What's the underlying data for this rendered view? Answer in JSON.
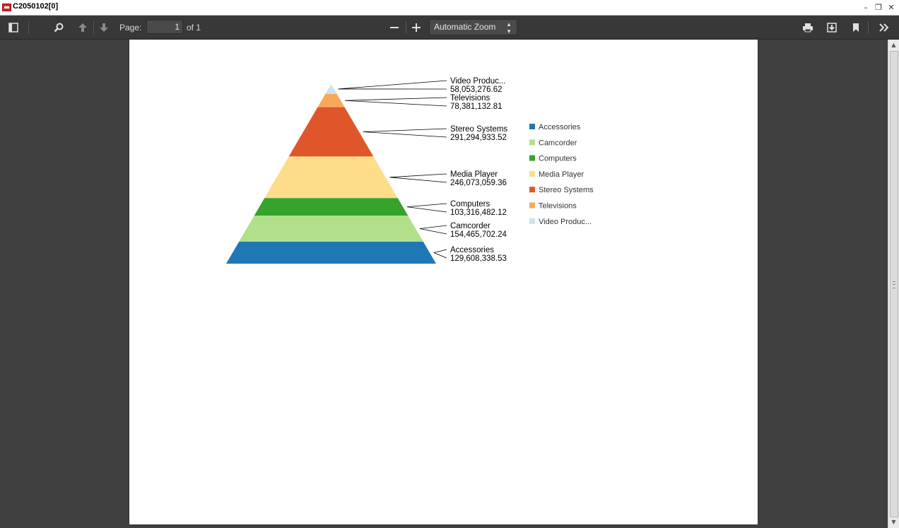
{
  "window": {
    "title": "C2050102[0]"
  },
  "toolbar": {
    "page_label": "Page:",
    "page_value": "1",
    "page_count": "of 1",
    "zoom_value": "Automatic Zoom"
  },
  "chart_data": {
    "type": "pyramid",
    "segments": [
      {
        "name": "Video Produc...",
        "value_label": "58,053,276.62",
        "value": 58053276.62,
        "color": "#cfe1f0"
      },
      {
        "name": "Televisions",
        "value_label": "78,381,132.81",
        "value": 78381132.81,
        "color": "#f9a75b"
      },
      {
        "name": "Stereo Systems",
        "value_label": "291,294,933.52",
        "value": 291294933.52,
        "color": "#e0562b"
      },
      {
        "name": "Media Player",
        "value_label": "246,073,059.36",
        "value": 246073059.36,
        "color": "#fddd8a"
      },
      {
        "name": "Computers",
        "value_label": "103,316,482.12",
        "value": 103316482.12,
        "color": "#36a32c"
      },
      {
        "name": "Camcorder",
        "value_label": "154,465,702.24",
        "value": 154465702.24,
        "color": "#b2df8a"
      },
      {
        "name": "Accessories",
        "value_label": "129,608,338.53",
        "value": 129608338.53,
        "color": "#1f78b4"
      }
    ],
    "legend": [
      {
        "label": "Accessories",
        "color": "#1f78b4"
      },
      {
        "label": "Camcorder",
        "color": "#b2df8a"
      },
      {
        "label": "Computers",
        "color": "#36a32c"
      },
      {
        "label": "Media Player",
        "color": "#fddd8a"
      },
      {
        "label": "Stereo Systems",
        "color": "#e0562b"
      },
      {
        "label": "Televisions",
        "color": "#f9a75b"
      },
      {
        "label": "Video Produc...",
        "color": "#cfe1f0"
      }
    ],
    "legend_position": "right"
  }
}
